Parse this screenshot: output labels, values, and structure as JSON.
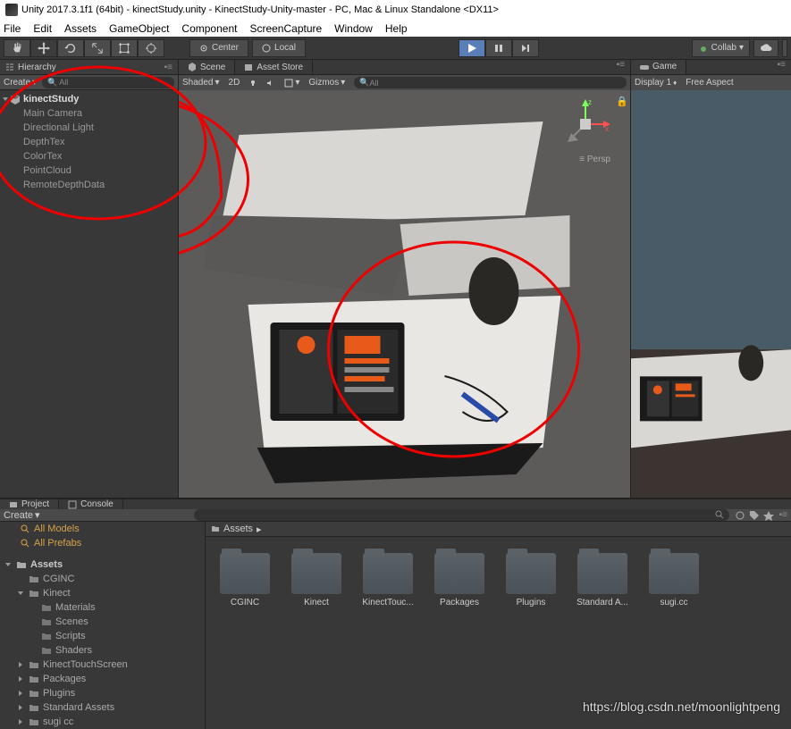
{
  "window_title": "Unity 2017.3.1f1 (64bit) - kinectStudy.unity - KinectStudy-Unity-master - PC, Mac & Linux Standalone <DX11>",
  "menubar": {
    "file": "File",
    "edit": "Edit",
    "assets": "Assets",
    "gameobject": "GameObject",
    "component": "Component",
    "screencapture": "ScreenCapture",
    "window": "Window",
    "help": "Help"
  },
  "toolbar": {
    "center": "Center",
    "local": "Local",
    "collab": "Collab"
  },
  "hierarchy": {
    "title": "Hierarchy",
    "create": "Create",
    "search_placeholder": "All",
    "scene_name": "kinectStudy",
    "items": [
      "Main Camera",
      "Directional Light",
      "DepthTex",
      "ColorTex",
      "PointCloud",
      "RemoteDepthData"
    ]
  },
  "scene": {
    "tab_scene": "Scene",
    "tab_asset_store": "Asset Store",
    "shading": "Shaded",
    "mode_2d": "2D",
    "gizmos": "Gizmos",
    "search": "All",
    "persp": "Persp"
  },
  "game": {
    "tab": "Game",
    "display": "Display 1",
    "aspect": "Free Aspect"
  },
  "project": {
    "tab_project": "Project",
    "tab_console": "Console",
    "create": "Create",
    "favorites": {
      "all_models": "All Models",
      "all_prefabs": "All Prefabs"
    },
    "assets_label": "Assets",
    "tree": [
      "CGINC",
      "Kinect",
      "Materials",
      "Scenes",
      "Scripts",
      "Shaders",
      "KinectTouchScreen",
      "Packages",
      "Plugins",
      "Standard Assets",
      "sugi cc"
    ],
    "breadcrumb": "Assets",
    "grid": [
      "CGINC",
      "Kinect",
      "KinectTouc...",
      "Packages",
      "Plugins",
      "Standard A...",
      "sugi.cc"
    ]
  },
  "watermark": "https://blog.csdn.net/moonlightpeng"
}
